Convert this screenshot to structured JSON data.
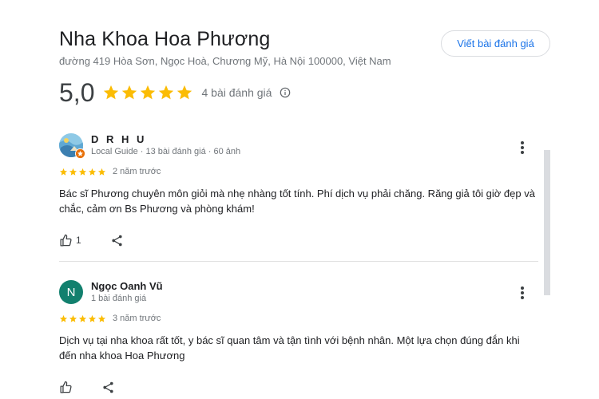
{
  "place": {
    "name": "Nha Khoa Hoa Phương",
    "address": "đường 419 Hòa Sơn, Ngọc Hoà, Chương Mỹ, Hà Nội 100000, Việt Nam",
    "write_review_label": "Viết bài đánh giá",
    "rating": "5,0",
    "stars": 5,
    "review_count_label": "4 bài đánh giá"
  },
  "colors": {
    "star": "#fbbc04",
    "link": "#1a73e8",
    "avatar_n": "#12806e"
  },
  "reviews": [
    {
      "author": "D R H U",
      "meta": "Local Guide · 13 bài đánh giá · 60 ảnh",
      "stars": 5,
      "date": "2 năm trước",
      "text": "Bác sĩ Phương chuyên môn giỏi mà nhẹ nhàng tốt tính. Phí dịch vụ phải chăng. Răng giả tôi giờ đẹp và chắc, cảm ơn Bs Phương và phòng khám!",
      "likes": "1"
    },
    {
      "author": "Ngọc Oanh Vũ",
      "avatar_letter": "N",
      "meta": "1 bài đánh giá",
      "stars": 5,
      "date": "3 năm trước",
      "text": "Dịch vụ tại nha khoa rất tốt, y bác sĩ quan tâm và tận tình với bệnh nhân. Một lựa chọn đúng đắn khi đến nha khoa Hoa Phương"
    }
  ]
}
